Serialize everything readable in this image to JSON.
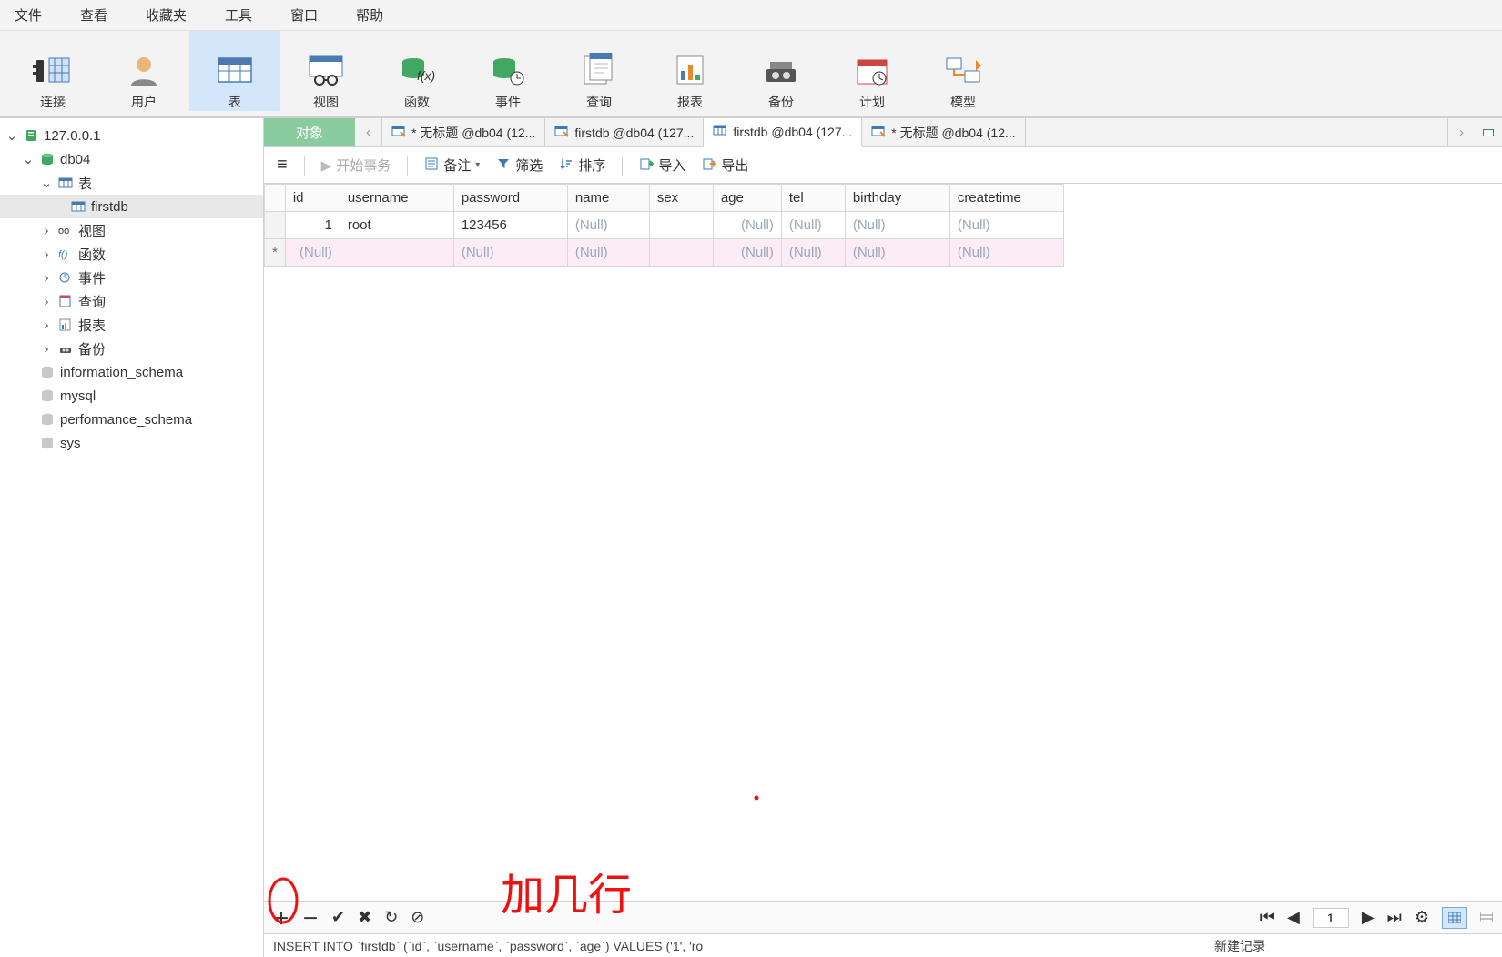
{
  "menubar": [
    "文件",
    "查看",
    "收藏夹",
    "工具",
    "窗口",
    "帮助"
  ],
  "ribbon": [
    {
      "name": "connect",
      "label": "连接"
    },
    {
      "name": "user",
      "label": "用户"
    },
    {
      "name": "table",
      "label": "表",
      "active": true
    },
    {
      "name": "view",
      "label": "视图"
    },
    {
      "name": "function",
      "label": "函数"
    },
    {
      "name": "event",
      "label": "事件"
    },
    {
      "name": "query",
      "label": "查询"
    },
    {
      "name": "report",
      "label": "报表"
    },
    {
      "name": "backup",
      "label": "备份"
    },
    {
      "name": "schedule",
      "label": "计划"
    },
    {
      "name": "model",
      "label": "模型"
    }
  ],
  "tree": {
    "server": "127.0.0.1",
    "db": "db04",
    "tables_label": "表",
    "table": "firstdb",
    "groups": [
      {
        "icon": "view",
        "label": "视图"
      },
      {
        "icon": "func",
        "label": "函数"
      },
      {
        "icon": "event",
        "label": "事件"
      },
      {
        "icon": "query",
        "label": "查询"
      },
      {
        "icon": "report",
        "label": "报表"
      },
      {
        "icon": "backup",
        "label": "备份"
      }
    ],
    "sysdbs": [
      "information_schema",
      "mysql",
      "performance_schema",
      "sys"
    ]
  },
  "tabs": {
    "object": "对象",
    "docs": [
      {
        "icon": "design",
        "title": "* 无标题 @db04 (12..."
      },
      {
        "icon": "design",
        "title": "firstdb @db04 (127..."
      },
      {
        "icon": "table",
        "title": "firstdb @db04 (127...",
        "active": true
      },
      {
        "icon": "design",
        "title": "* 无标题 @db04 (12..."
      }
    ]
  },
  "toolbar2": {
    "begin_tx": "开始事务",
    "memo": "备注",
    "filter": "筛选",
    "sort": "排序",
    "import": "导入",
    "export": "导出"
  },
  "grid": {
    "columns": [
      "id",
      "username",
      "password",
      "name",
      "sex",
      "age",
      "tel",
      "birthday",
      "createtime"
    ],
    "rows": [
      {
        "id": "1",
        "username": "root",
        "password": "123456",
        "name": null,
        "sex": "",
        "age": null,
        "tel": null,
        "birthday": null,
        "createtime": null
      }
    ],
    "null_text": "(Null)"
  },
  "recordbar": {
    "page": "1"
  },
  "status": {
    "sql": "INSERT INTO `firstdb` (`id`, `username`, `password`, `age`) VALUES ('1', 'ro",
    "msg": "新建记录"
  },
  "annotation": "加几行"
}
